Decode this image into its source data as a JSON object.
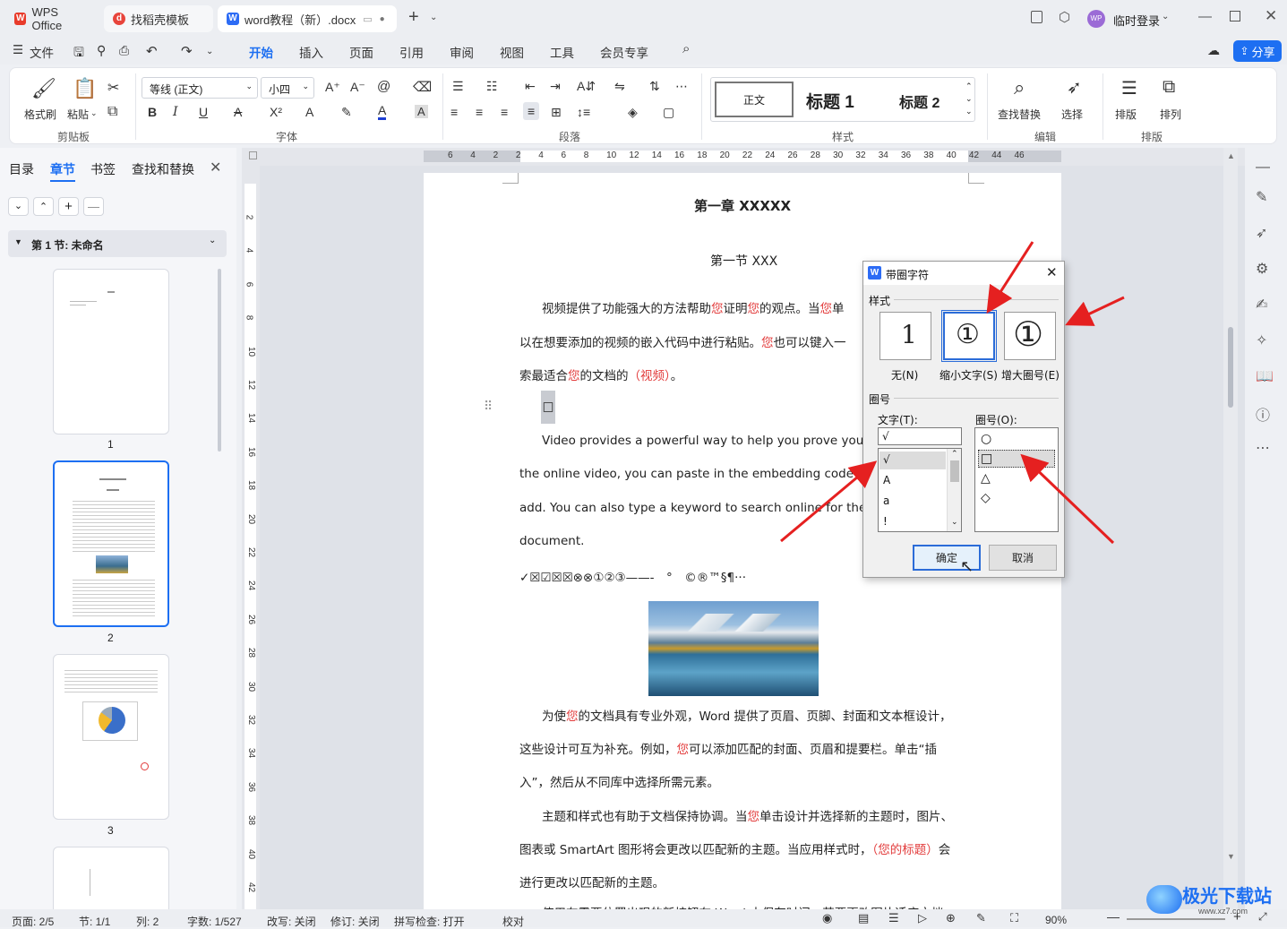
{
  "titlebar": {
    "tabs": [
      {
        "label": "WPS Office"
      },
      {
        "label": "找稻壳模板"
      },
      {
        "label": "word教程（新）.docx"
      }
    ],
    "login": "临时登录",
    "avatar": "WP"
  },
  "menubar": {
    "file": "文件",
    "items": [
      "开始",
      "插入",
      "页面",
      "引用",
      "审阅",
      "视图",
      "工具",
      "会员专享"
    ],
    "share": "分享"
  },
  "ribbon": {
    "format_painter": "格式刷",
    "paste": "粘贴",
    "clipboard_group": "剪贴板",
    "font_name": "等线 (正文)",
    "font_size": "小四",
    "font_group": "字体",
    "paragraph_group": "段落",
    "styles": [
      "正文",
      "标题 1",
      "标题 2"
    ],
    "styles_group": "样式",
    "find_replace": "查找替换",
    "select": "选择",
    "edit_group": "编辑",
    "layout": "排版",
    "arrange": "排列",
    "layout_group": "排版"
  },
  "leftpanel": {
    "tabs": [
      "目录",
      "章节",
      "书签",
      "查找和替换"
    ],
    "section": "第 1 节: 未命名",
    "pages": [
      "1",
      "2",
      "3"
    ]
  },
  "ruler": {
    "h_ticks": [
      "6",
      "4",
      "2",
      "2",
      "4",
      "6",
      "8",
      "10",
      "12",
      "14",
      "16",
      "18",
      "20",
      "22",
      "24",
      "26",
      "28",
      "30",
      "32",
      "34",
      "36",
      "38",
      "40",
      "42",
      "44",
      "46"
    ],
    "v_ticks": [
      "2",
      "4",
      "6",
      "8",
      "10",
      "12",
      "14",
      "16",
      "18",
      "20",
      "22",
      "24",
      "26",
      "28",
      "30",
      "32",
      "34",
      "36",
      "38",
      "40",
      "42"
    ]
  },
  "document": {
    "chapter": "第一章 XXXXX",
    "section": "第一节 XXX",
    "p1_line1_a": "视频提供了功能强大的方法帮助",
    "p1_you1": "您",
    "p1_line1_b": "证明",
    "p1_you2": "您",
    "p1_line1_c": "的观点。当",
    "p1_you3": "您",
    "p1_line1_d": "单",
    "p1_line2_a": "以在想要添加的视频的嵌入代码中进行粘贴。",
    "p1_you4": "您",
    "p1_line2_b": "也可以键入一",
    "p1_line3_a": "索最适合",
    "p1_you5": "您",
    "p1_line3_b": "的文档的",
    "p1_line3_red": "（视频）",
    "p1_line3_c": "。",
    "box_char": "□",
    "en1": "Video provides a powerful way to help you prove your po",
    "en2": "the online video, you can paste in the embedding code for th",
    "en3": "add. You can also type a keyword to search online for the vide",
    "en4": "document.",
    "symbols": "✓☒☑☒☒⊗⊗①②③——-　°　©®™§¶···",
    "p2_line1_a": "为使",
    "p2_you1": "您",
    "p2_line1_b": "的文档具有专业外观，Word 提供了页眉、页脚、封面和文本框设计，",
    "p2_line2_a": "这些设计可互为补充。例如，",
    "p2_you2": "您",
    "p2_line2_b": "可以添加匹配的封面、页眉和提要栏。单击“插",
    "p2_line3": "入”，然后从不同库中选择所需元素。",
    "p3_line1_a": "主题和样式也有助于文档保持协调。当",
    "p3_you1": "您",
    "p3_line1_b": "单击设计并选择新的主题时，图片、",
    "p3_line2_a": "图表或 SmartArt 图形将会更改以匹配新的主题。当应用样式时，",
    "p3_line2_red": "（您的标题）",
    "p3_line2_b": "会",
    "p3_line3": "进行更改以匹配新的主题。",
    "p4_partial": "使用在需要位置出现的新按钮在 Word 中保存时间。若要更改图片适应文档"
  },
  "dialog": {
    "title": "带圈字符",
    "style_label": "样式",
    "style_options": [
      {
        "label": "无(N)",
        "glyph": "1"
      },
      {
        "label": "缩小文字(S)",
        "glyph": "①"
      },
      {
        "label": "增大圈号(E)",
        "glyph": "①"
      }
    ],
    "selected_style": "缩小文字(S)",
    "circle_label": "圈号",
    "text_label": "文字(T):",
    "text_value": "√",
    "text_options": [
      "√",
      "A",
      "a",
      "!"
    ],
    "enclosure_label": "圈号(O):",
    "enclosure_options": [
      "○",
      "□",
      "△",
      "◇"
    ],
    "selected_enclosure": "□",
    "ok": "确定",
    "cancel": "取消"
  },
  "statusbar": {
    "page": "页面: 2/5",
    "section": "节: 1/1",
    "column": "列: 2",
    "words": "字数: 1/527",
    "overtype": "改写: 关闭",
    "revise": "修订: 关闭",
    "spellcheck": "拼写检查: 打开",
    "proof": "校对",
    "zoom": "90%"
  },
  "watermark": "极光下载站",
  "watermark_url": "www.xz7.com",
  "colors": {
    "accent": "#1d6ff2",
    "red": "#e23b3b",
    "arrow": "#e52020"
  }
}
